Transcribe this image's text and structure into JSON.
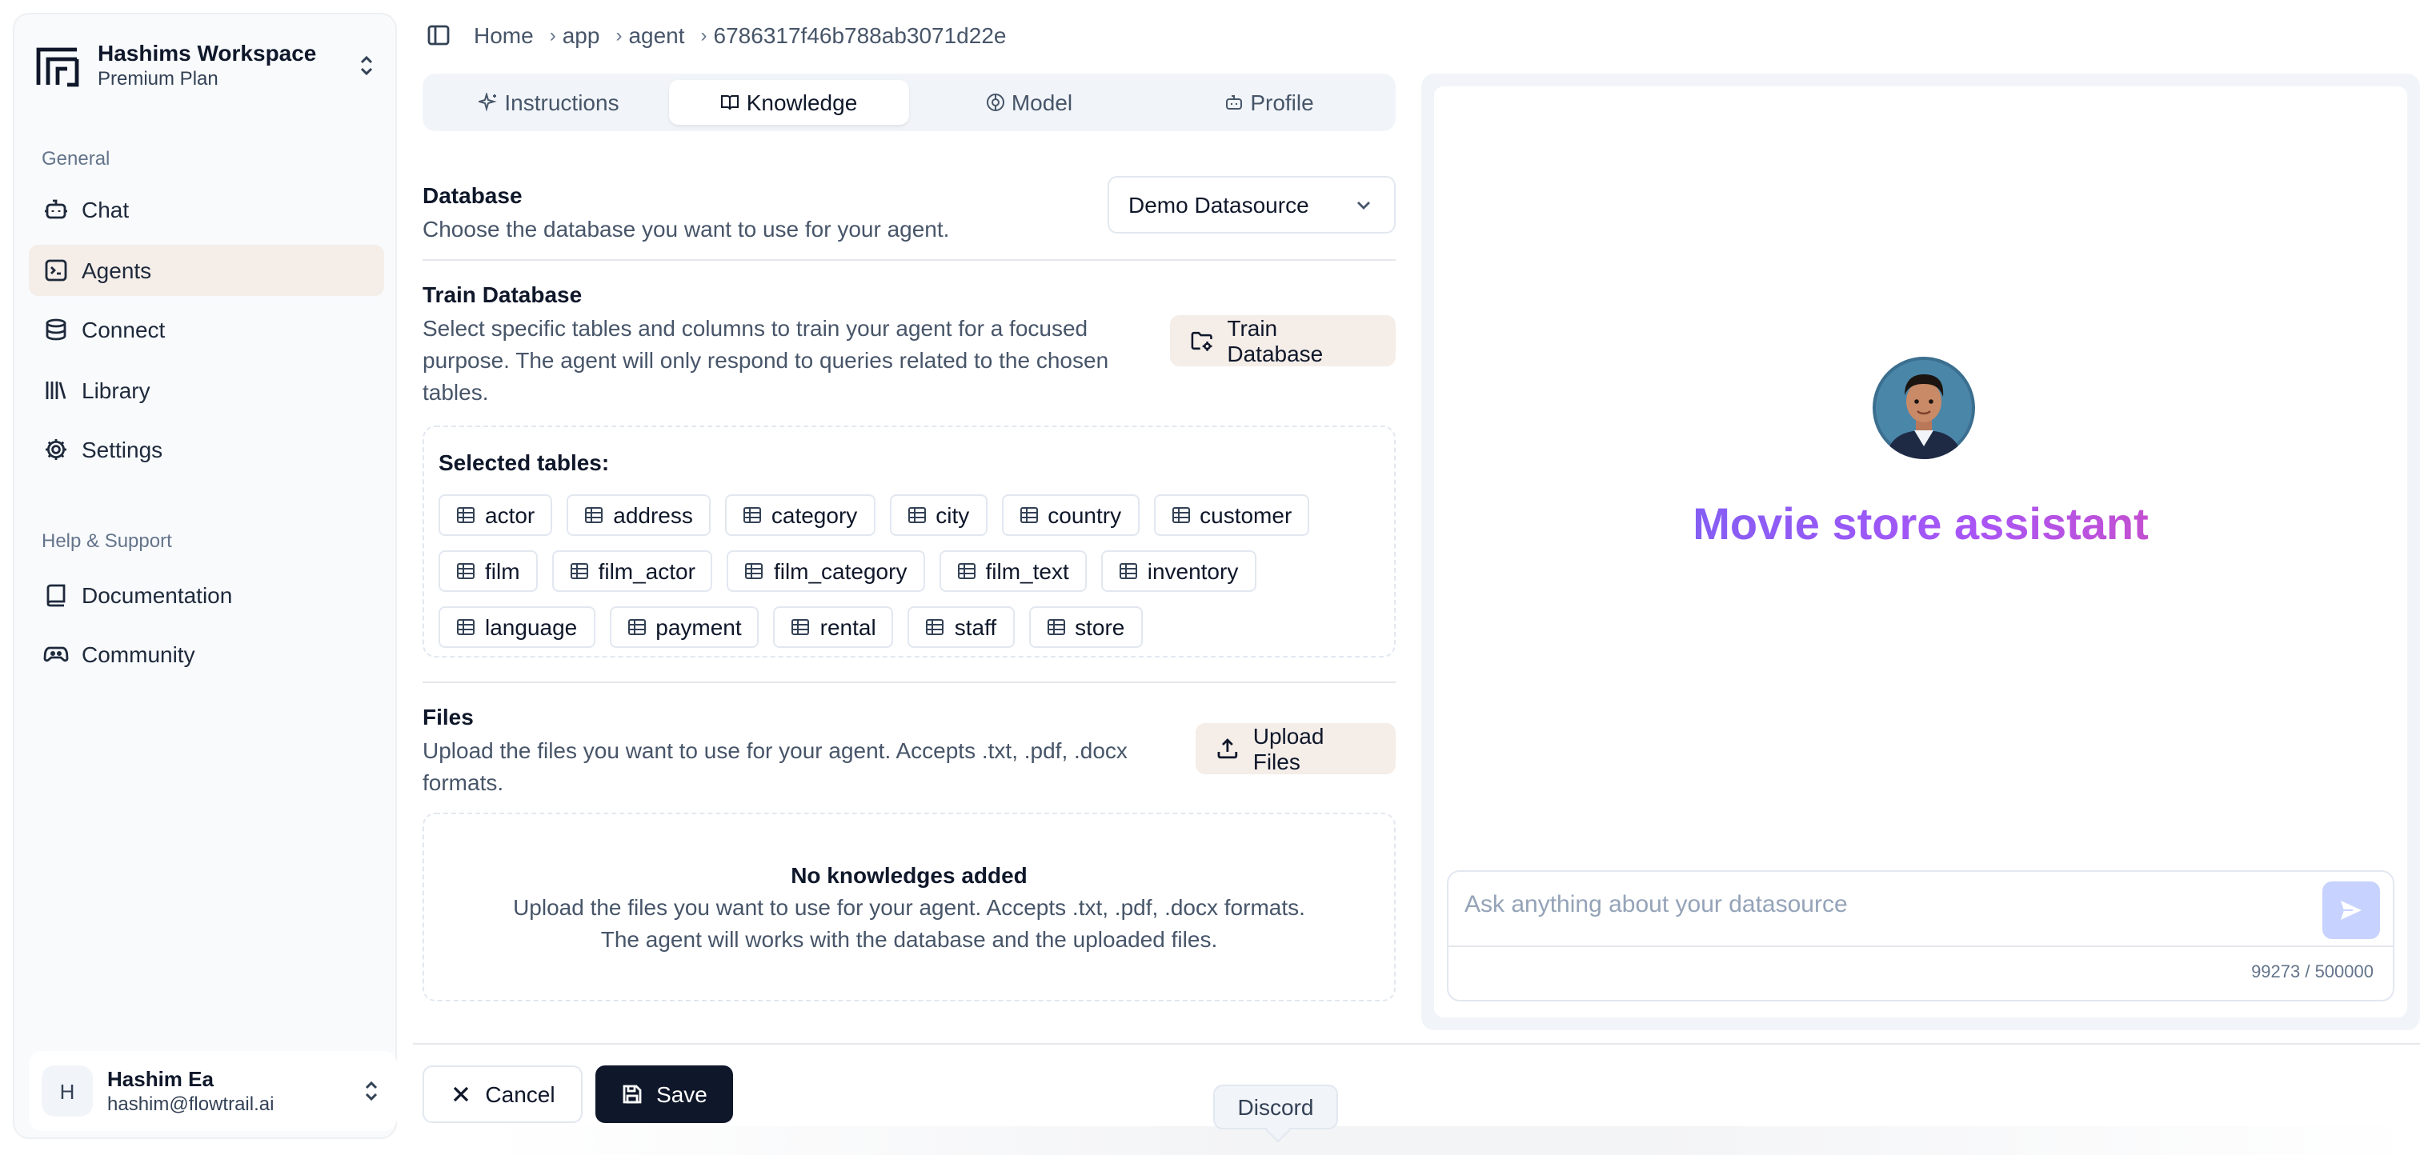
{
  "workspace": {
    "title": "Hashims Workspace",
    "plan": "Premium Plan"
  },
  "sidebar": {
    "general_label": "General",
    "items": [
      {
        "label": "Chat",
        "icon": "bot-icon"
      },
      {
        "label": "Agents",
        "icon": "terminal-square-icon"
      },
      {
        "label": "Connect",
        "icon": "database-icon"
      },
      {
        "label": "Library",
        "icon": "library-icon"
      },
      {
        "label": "Settings",
        "icon": "gear-icon"
      }
    ],
    "help_label": "Help & Support",
    "help_items": [
      {
        "label": "Documentation",
        "icon": "book-icon"
      },
      {
        "label": "Community",
        "icon": "gamepad-icon"
      }
    ]
  },
  "user": {
    "initial": "H",
    "name": "Hashim Ea",
    "email": "hashim@flowtrail.ai"
  },
  "breadcrumb": {
    "items": [
      "Home",
      "app",
      "agent",
      "6786317f46b788ab3071d22e"
    ]
  },
  "tabs": [
    {
      "label": "Instructions"
    },
    {
      "label": "Knowledge"
    },
    {
      "label": "Model"
    },
    {
      "label": "Profile"
    }
  ],
  "database": {
    "title": "Database",
    "description": "Choose the database you want to use for your agent.",
    "selected": "Demo Datasource"
  },
  "train": {
    "title": "Train Database",
    "description_lines": [
      "Select specific tables and columns to train your agent for a focused",
      "purpose. The agent will only respond to queries related to the chosen",
      "tables."
    ],
    "button": "Train Database",
    "selected_label": "Selected tables:",
    "tables_rows": [
      [
        "actor",
        "address",
        "category",
        "city",
        "country",
        "customer"
      ],
      [
        "film",
        "film_actor",
        "film_category",
        "film_text",
        "inventory"
      ],
      [
        "language",
        "payment",
        "rental",
        "staff",
        "store"
      ]
    ]
  },
  "files": {
    "title": "Files",
    "description_lines": [
      "Upload the files you want to use for your agent. Accepts .txt, .pdf, .docx",
      "formats."
    ],
    "button": "Upload Files",
    "empty_title": "No knowledges added",
    "empty_line1": "Upload the files you want to use for your agent. Accepts .txt, .pdf, .docx formats.",
    "empty_line2": "The agent will works with the database and the uploaded files."
  },
  "actions": {
    "cancel": "Cancel",
    "save": "Save"
  },
  "tooltip": {
    "discord": "Discord"
  },
  "chat": {
    "agent_name": "Movie store assistant",
    "placeholder": "Ask anything about your datasource",
    "counter": "99273 / 500000"
  },
  "colors": {
    "active_nav_bg": "#f4ede8",
    "primary_button": "#0f172a",
    "title_gradient": [
      "#6366f1",
      "#a855f7",
      "#ec4899"
    ],
    "send_button": "#c7d2fe"
  }
}
